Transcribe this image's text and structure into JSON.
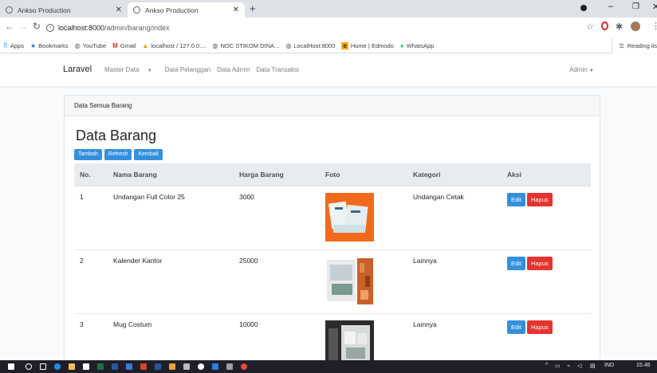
{
  "browser": {
    "tabs": [
      {
        "title": "Ankso Production"
      },
      {
        "title": "Ankso Production"
      }
    ],
    "new_tab": "+",
    "url_host": "localhost:8000",
    "url_path": "/admin/barang/index",
    "bookmarks": [
      {
        "label": "Apps",
        "icon": "apps-grid-icon"
      },
      {
        "label": "Bookmarks",
        "icon": "star-icon"
      },
      {
        "label": "YouTube",
        "icon": "globe-icon"
      },
      {
        "label": "Gmail",
        "icon": "gmail-icon"
      },
      {
        "label": "localhost / 127.0.0....",
        "icon": "phpmyadmin-icon"
      },
      {
        "label": "NOC STIKOM DINA...",
        "icon": "globe-icon"
      },
      {
        "label": "LocalHost:8000",
        "icon": "globe-icon"
      },
      {
        "label": "Home | Edmodo",
        "icon": "edmodo-icon"
      },
      {
        "label": "WhatsApp",
        "icon": "whatsapp-icon"
      }
    ],
    "reading_list": "Reading lis"
  },
  "navbar": {
    "brand": "Laravel",
    "menu": [
      "Master Data",
      "Data Pelanggan",
      "Data Admin",
      "Data Transaksi"
    ],
    "user": "Admin"
  },
  "card": {
    "header": "Data Semua Barang",
    "title": "Data Barang",
    "buttons": {
      "tambah": "Tambah",
      "refresh": "Refresh",
      "kembali": "Kembali"
    }
  },
  "table": {
    "headers": [
      "No.",
      "Nama Barang",
      "Harga Barang",
      "Foto",
      "Kategori",
      "Aksi"
    ],
    "rows": [
      {
        "no": "1",
        "nama": "Undangan Full Color 25",
        "harga": "3000",
        "kategori": "Undangan Cetak",
        "photo": "invitation-cards-photo"
      },
      {
        "no": "2",
        "nama": "Kalender Kantor",
        "harga": "25000",
        "kategori": "Lainnya",
        "photo": "desk-calendar-photo"
      },
      {
        "no": "3",
        "nama": "Mug Costum",
        "harga": "10000",
        "kategori": "Lainnya",
        "photo": "custom-mugs-photo"
      }
    ],
    "edit_label": "Edit",
    "hapus_label": "Hapus"
  },
  "taskbar": {
    "lang": "IND",
    "time": "15.46"
  },
  "colors": {
    "primary": "#3490dc",
    "danger": "#e3342f",
    "orange": "#f26a1b"
  }
}
